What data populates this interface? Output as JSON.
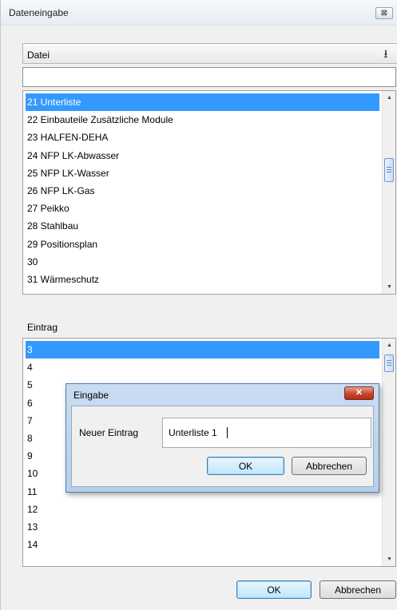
{
  "window": {
    "title": "Dateneingabe",
    "close_glyph": "⊠"
  },
  "datei": {
    "label": "Datei",
    "download_icon": "download-icon",
    "download_glyph": "⭳",
    "path_value": "",
    "items": [
      "21 Unterliste",
      "22 Einbauteile Zusätzliche Module",
      "23 HALFEN-DEHA",
      "24 NFP LK-Abwasser",
      "25 NFP LK-Wasser",
      "26 NFP LK-Gas",
      "27 Peikko",
      "28 Stahlbau",
      "29 Positionsplan",
      "30",
      "31 Wärmeschutz"
    ],
    "selected_index": 0
  },
  "eintrag": {
    "label": "Eintrag",
    "items": [
      "3",
      "4",
      "5",
      "6",
      "7",
      "8",
      "9",
      "10",
      "11",
      "12",
      "13",
      "14"
    ],
    "selected_index": 0
  },
  "scroll": {
    "up_glyph": "▲",
    "down_glyph": "▼"
  },
  "dialog": {
    "title": "Eingabe",
    "close_glyph": "✕",
    "field_label": "Neuer Eintrag",
    "field_value": "Unterliste 1",
    "ok_label": "OK",
    "cancel_label": "Abbrechen"
  },
  "footer": {
    "ok_label": "OK",
    "cancel_label": "Abbrechen"
  },
  "colors": {
    "selection": "#3399ff",
    "dialog_frame": "#b7cfe9",
    "close_red": "#c7452a"
  }
}
